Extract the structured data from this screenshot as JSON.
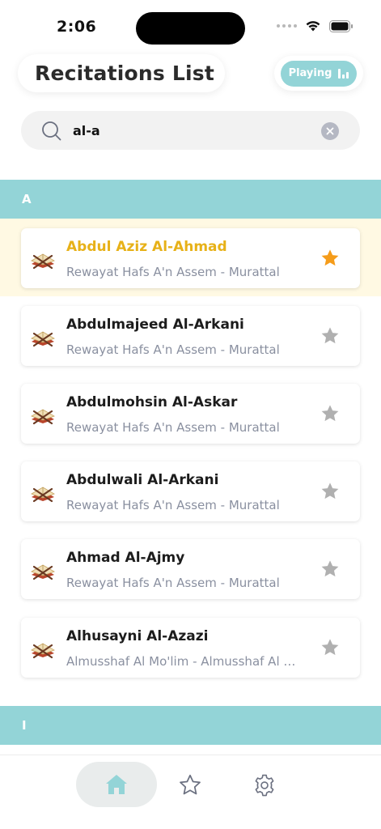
{
  "status_bar": {
    "time": "2:06"
  },
  "header": {
    "title": "Recitations List",
    "playing_label": "Playing"
  },
  "search": {
    "value": "al-a",
    "placeholder": ""
  },
  "sections": [
    {
      "letter": "A"
    },
    {
      "letter": "I"
    }
  ],
  "reciters": [
    {
      "name": "Abdul Aziz Al-Ahmad",
      "riwaya": "Rewayat Hafs A'n Assem - Murattal",
      "favorite": true
    },
    {
      "name": "Abdulmajeed Al-Arkani",
      "riwaya": "Rewayat Hafs A'n Assem - Murattal",
      "favorite": false
    },
    {
      "name": "Abdulmohsin Al-Askar",
      "riwaya": "Rewayat Hafs A'n Assem - Murattal",
      "favorite": false
    },
    {
      "name": "Abdulwali Al-Arkani",
      "riwaya": "Rewayat Hafs A'n Assem - Murattal",
      "favorite": false
    },
    {
      "name": "Ahmad Al-Ajmy",
      "riwaya": "Rewayat Hafs A'n Assem - Murattal",
      "favorite": false
    },
    {
      "name": "Alhusayni Al-Azazi",
      "riwaya": "Almusshaf Al Mo'lim - Almusshaf Al Mo'lim",
      "favorite": false
    }
  ],
  "colors": {
    "accent": "#93d4d7",
    "active_name": "#e7b118",
    "favorite_star": "#f59c1a",
    "inactive_star": "#b0b0b0",
    "highlight_row": "#fff9e3"
  },
  "icons": {
    "search": "search-icon",
    "clear": "clear-icon",
    "reciter": "quran-book-icon",
    "favorite": "star-icon",
    "home": "home-icon",
    "favorites_tab": "star-outline-icon",
    "settings": "gear-icon"
  }
}
